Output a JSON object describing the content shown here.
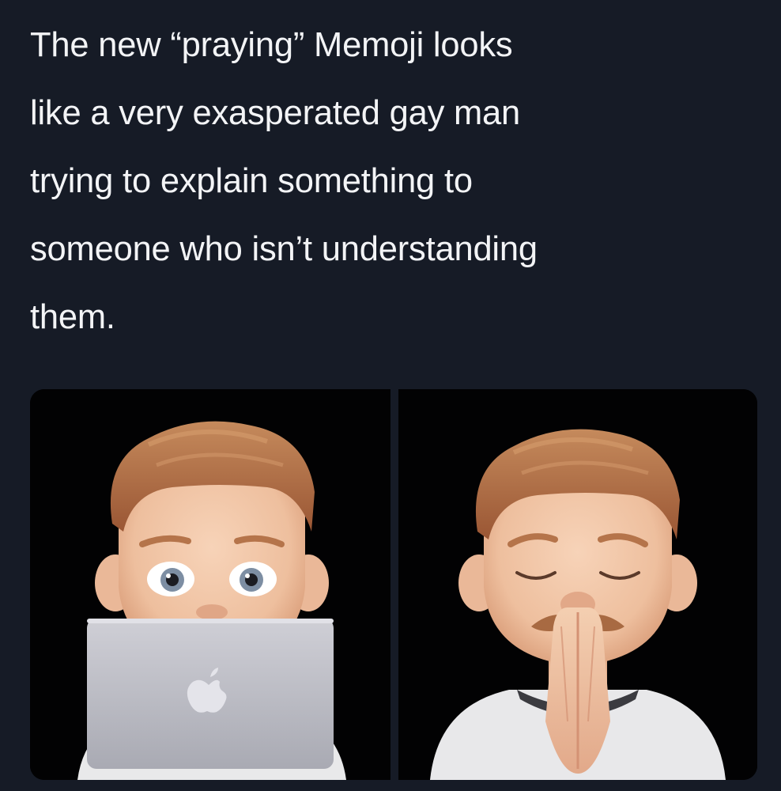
{
  "tweet": {
    "text_lines": [
      "The new “praying” Memoji looks",
      "like a very exasperated gay man",
      "trying to explain something to",
      "someone who isn’t understanding",
      "them."
    ]
  },
  "media": {
    "images": [
      {
        "icon": "memoji-laptop-icon"
      },
      {
        "icon": "memoji-praying-icon"
      }
    ]
  },
  "colors": {
    "background": "#161b26",
    "text": "#f3f4f6",
    "hair": "#b06d44",
    "skin": "#f2c6a6"
  }
}
